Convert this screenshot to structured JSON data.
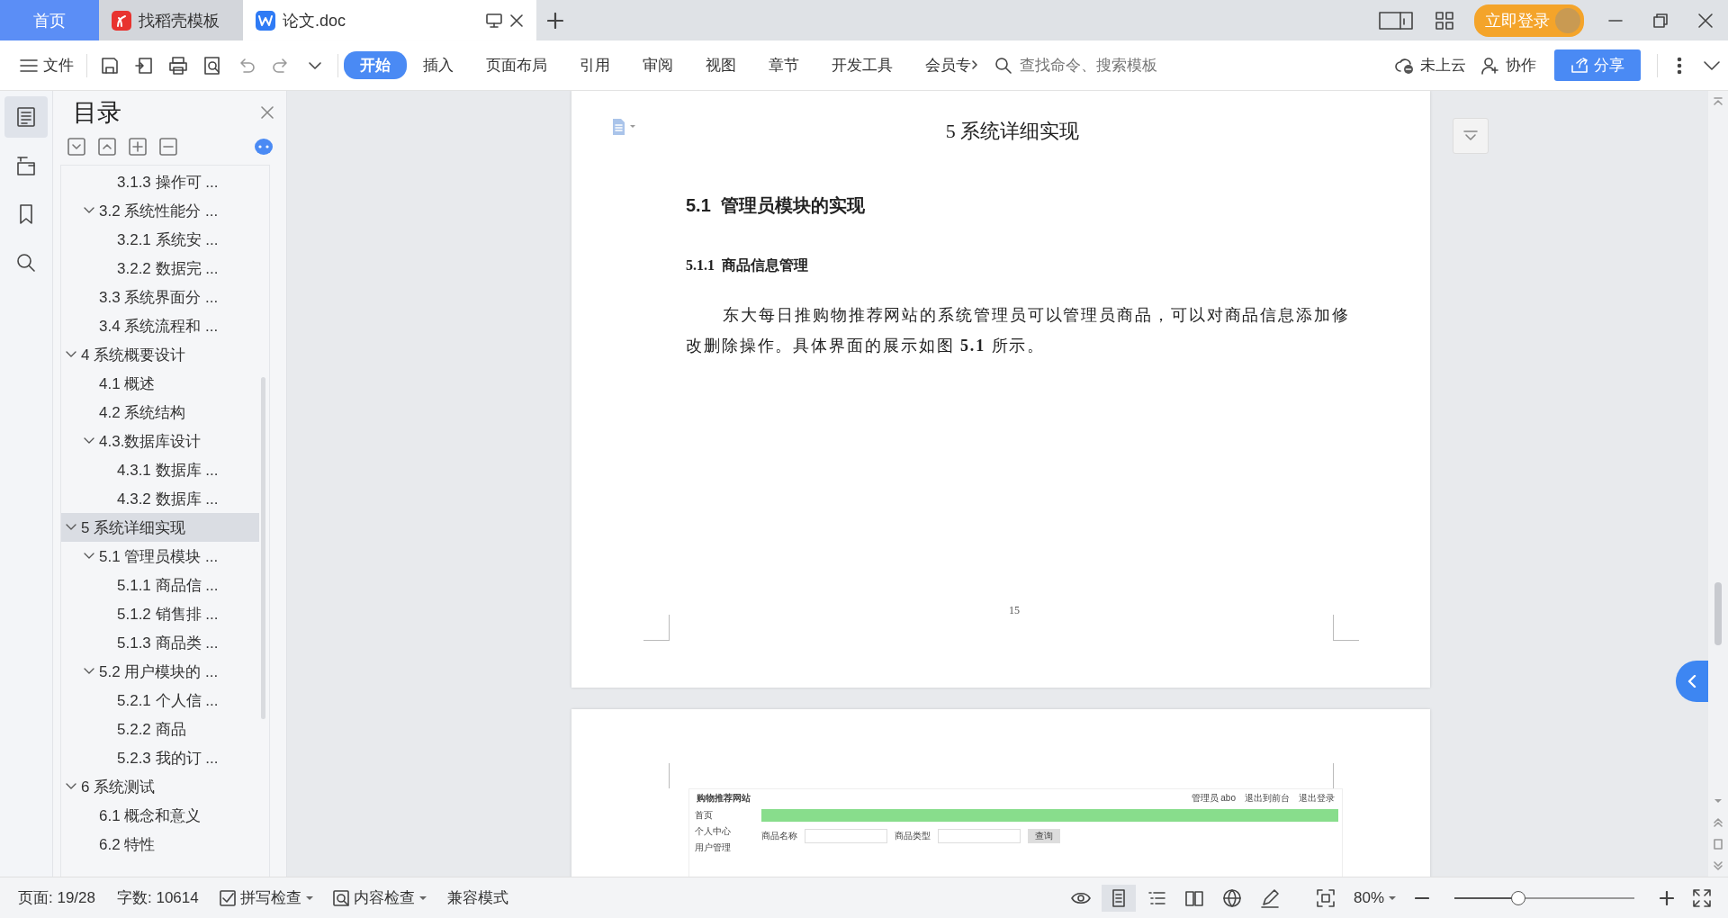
{
  "tabs": [
    {
      "label": "首页",
      "kind": "home",
      "selected": false
    },
    {
      "label": "找稻壳模板",
      "kind": "docer",
      "selected": false
    },
    {
      "label": "论文.doc",
      "kind": "doc",
      "selected": true
    }
  ],
  "title_bar": {
    "login_button": "立即登录"
  },
  "menu": {
    "file": "文件",
    "ribbon_tabs": [
      {
        "label": "开始",
        "selected": true
      },
      {
        "label": "插入",
        "selected": false
      },
      {
        "label": "页面布局",
        "selected": false
      },
      {
        "label": "引用",
        "selected": false
      },
      {
        "label": "审阅",
        "selected": false
      },
      {
        "label": "视图",
        "selected": false
      },
      {
        "label": "章节",
        "selected": false
      },
      {
        "label": "开发工具",
        "selected": false
      },
      {
        "label": "会员专",
        "selected": false
      }
    ],
    "search": {
      "placeholder": "查找命令、搜索模板"
    },
    "cloud": "未上云",
    "collab": "协作",
    "share": "分享"
  },
  "rail": [
    {
      "kind": "toc",
      "selected": true
    },
    {
      "kind": "nav",
      "selected": false
    },
    {
      "kind": "bookmark",
      "selected": false
    },
    {
      "kind": "search",
      "selected": false
    }
  ],
  "toc": {
    "title": "目录",
    "items": [
      {
        "children": [
          {
            "children": [
              {
                "label": "3.1.3 操作可 ...",
                "selected": false
              }
            ]
          },
          {
            "label": "3.2 系统性能分 ...",
            "expanded": true,
            "selected": false,
            "children": [
              {
                "label": "3.2.1 系统安 ...",
                "selected": false
              },
              {
                "label": "3.2.2 数据完 ...",
                "selected": false
              }
            ]
          },
          {
            "label": "3.3 系统界面分 ...",
            "selected": false
          },
          {
            "label": "3.4 系统流程和 ...",
            "selected": false
          }
        ]
      },
      {
        "label": "4 系统概要设计",
        "expanded": true,
        "selected": false,
        "children": [
          {
            "label": "4.1 概述",
            "selected": false
          },
          {
            "label": "4.2 系统结构",
            "selected": false
          },
          {
            "label": "4.3.数据库设计",
            "expanded": true,
            "selected": false,
            "children": [
              {
                "label": "4.3.1 数据库 ...",
                "selected": false
              },
              {
                "label": "4.3.2 数据库 ...",
                "selected": false
              }
            ]
          }
        ]
      },
      {
        "label": "5 系统详细实现",
        "expanded": true,
        "selected": true,
        "children": [
          {
            "label": "5.1 管理员模块 ...",
            "expanded": true,
            "selected": false,
            "children": [
              {
                "label": "5.1.1 商品信 ...",
                "selected": false
              },
              {
                "label": "5.1.2 销售排 ...",
                "selected": false
              },
              {
                "label": "5.1.3 商品类 ...",
                "selected": false
              }
            ]
          },
          {
            "label": "5.2 用户模块的 ...",
            "expanded": true,
            "selected": false,
            "children": [
              {
                "label": "5.2.1 个人信 ...",
                "selected": false
              },
              {
                "label": "5.2.2 商品",
                "selected": false
              },
              {
                "label": "5.2.3 我的订 ...",
                "selected": false
              }
            ]
          }
        ]
      },
      {
        "label": "6 系统测试",
        "expanded": true,
        "selected": false,
        "children": [
          {
            "label": "6.1 概念和意义",
            "selected": false
          },
          {
            "label": "6.2 特性",
            "selected": false
          }
        ]
      }
    ]
  },
  "document": {
    "page": {
      "chapter": "5 系统详细实现",
      "section": "5.1  管理员模块的实现",
      "subsection": "5.1.1  商品信息管理",
      "paragraph": "东大每日推购物推荐网站的系统管理员可以管理员商品，可以对商品信息添加修改删除操作。具体界面的展示如图 **5.1** 所示。",
      "page_number": "15"
    },
    "figure": {
      "site_title": "购物推荐网站",
      "header_links": [
        "管理员 abo",
        "退出到前台",
        "退出登录"
      ],
      "menu": [
        "首页",
        "个人中心",
        "用户管理"
      ],
      "filters": [
        "商品名称",
        "商品类型"
      ],
      "query_button": "查询"
    }
  },
  "status_bar": {
    "page": "页面: 19/28",
    "words": "字数: 10614",
    "spell_check": "拼写检查",
    "content_check": "内容检查",
    "compat": "兼容模式",
    "zoom": "80%",
    "zoom_slider": {
      "level": 0.36
    }
  }
}
